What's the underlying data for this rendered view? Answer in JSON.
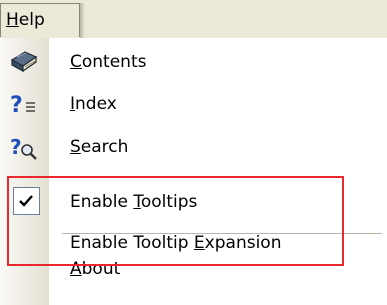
{
  "menubar": {
    "title": "Help",
    "title_accel": "H",
    "title_rest": "elp"
  },
  "menu": {
    "items": [
      {
        "id": "contents",
        "label": "Contents",
        "accel": "C",
        "pre": "",
        "post": "ontents",
        "icon": "book-icon"
      },
      {
        "id": "index",
        "label": "Index",
        "accel": "I",
        "pre": "",
        "post": "ndex",
        "icon": "help-index-icon"
      },
      {
        "id": "search",
        "label": "Search",
        "accel": "S",
        "pre": "",
        "post": "earch",
        "icon": "help-search-icon"
      },
      {
        "id": "enable-tooltips",
        "label": "Enable Tooltips",
        "accel": "T",
        "pre": "Enable ",
        "post": "ooltips",
        "checked": true
      },
      {
        "id": "enable-tooltip-expansion",
        "label": "Enable Tooltip Expansion",
        "accel": "E",
        "pre": "Enable Tooltip ",
        "post": "xpansion",
        "checked": false
      },
      {
        "id": "about",
        "label": "About",
        "accel": "A",
        "pre": "",
        "post": "bout"
      }
    ]
  },
  "colors": {
    "highlight_border": "#e8292e",
    "help_icon_blue": "#1f4fb8",
    "menubar_bg": "#ece9d8"
  }
}
